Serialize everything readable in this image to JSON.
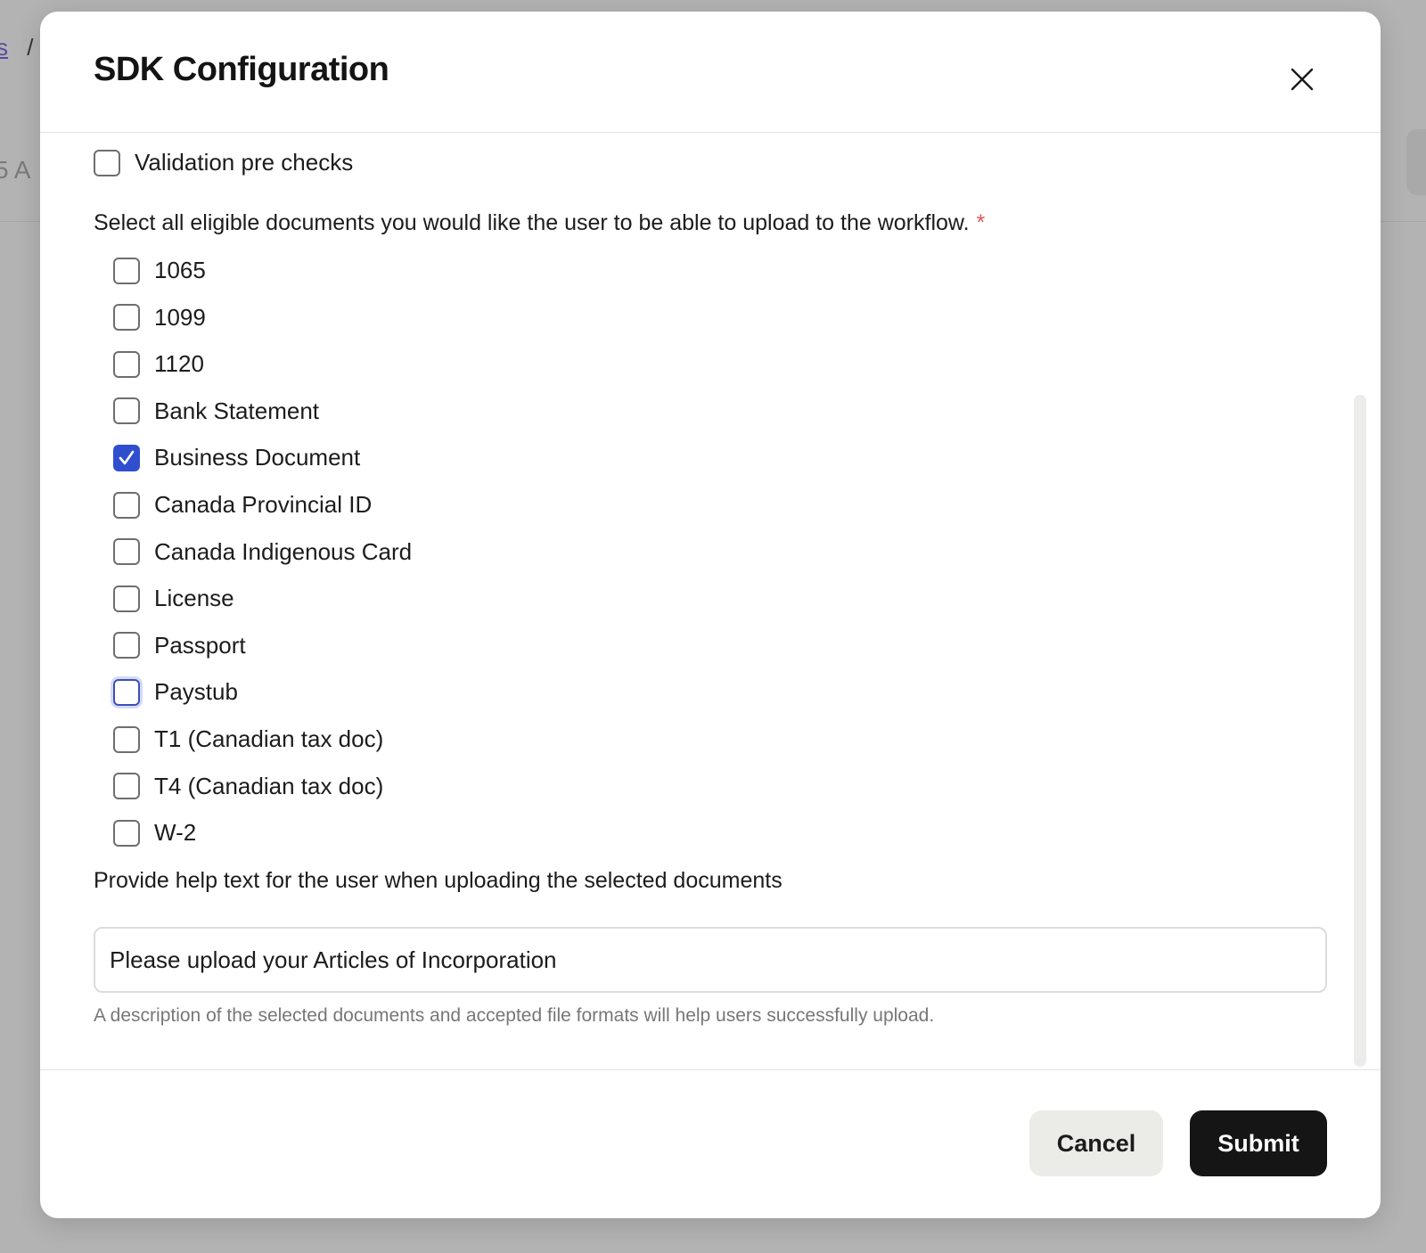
{
  "background": {
    "breadcrumb_link": "s",
    "breadcrumb_sep": "/",
    "fragment_text": "5 A"
  },
  "modal": {
    "title": "SDK Configuration",
    "close_icon": "close-icon"
  },
  "validation": {
    "label": "Validation pre checks",
    "checked": false
  },
  "documents": {
    "prompt": "Select all eligible documents you would like the user to be able to upload to the workflow.",
    "required_marker": "*",
    "options": [
      {
        "label": "1065",
        "checked": false
      },
      {
        "label": "1099",
        "checked": false
      },
      {
        "label": "1120",
        "checked": false
      },
      {
        "label": "Bank Statement",
        "checked": false
      },
      {
        "label": "Business Document",
        "checked": true
      },
      {
        "label": "Canada Provincial ID",
        "checked": false
      },
      {
        "label": "Canada Indigenous Card",
        "checked": false
      },
      {
        "label": "License",
        "checked": false
      },
      {
        "label": "Passport",
        "checked": false
      },
      {
        "label": "Paystub",
        "checked": false
      },
      {
        "label": "T1 (Canadian tax doc)",
        "checked": false
      },
      {
        "label": "T4 (Canadian tax doc)",
        "checked": false
      },
      {
        "label": "W-2",
        "checked": false
      }
    ]
  },
  "help_text": {
    "label": "Provide help text for the user when uploading the selected documents",
    "value": "Please upload your Articles of Incorporation",
    "hint": "A description of the selected documents and accepted file formats will help users successfully upload."
  },
  "footer": {
    "cancel_label": "Cancel",
    "submit_label": "Submit"
  },
  "colors": {
    "accent": "#2f4fcf",
    "required": "#e05555",
    "submit_bg": "#151515",
    "cancel_bg": "#ebebe8"
  }
}
